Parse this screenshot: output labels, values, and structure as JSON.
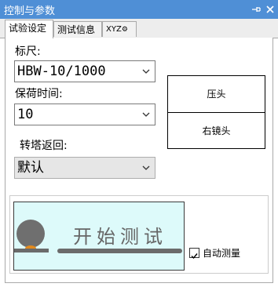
{
  "window": {
    "title": "控制与参数",
    "pin_icon": "pin-icon",
    "close_icon": "close-icon"
  },
  "tabs": [
    {
      "label": "试验设定",
      "active": true
    },
    {
      "label": "测试信息",
      "active": false
    },
    {
      "label": "XYZ",
      "active": false,
      "icon": "gear-icon"
    }
  ],
  "form": {
    "scale_label": "标尺:",
    "scale_value": "HBW-10/1000",
    "hold_time_label": "保荷时间:",
    "hold_time_value": "10",
    "turret_return_label": "转塔返回:",
    "turret_return_value": "默认"
  },
  "turret_box": {
    "indenter_label": "压头",
    "right_lens_label": "右镜头"
  },
  "start": {
    "label": "开始测试",
    "bg_color": "#ddfafa"
  },
  "auto_measure": {
    "label": "自动测量",
    "checked": true
  }
}
